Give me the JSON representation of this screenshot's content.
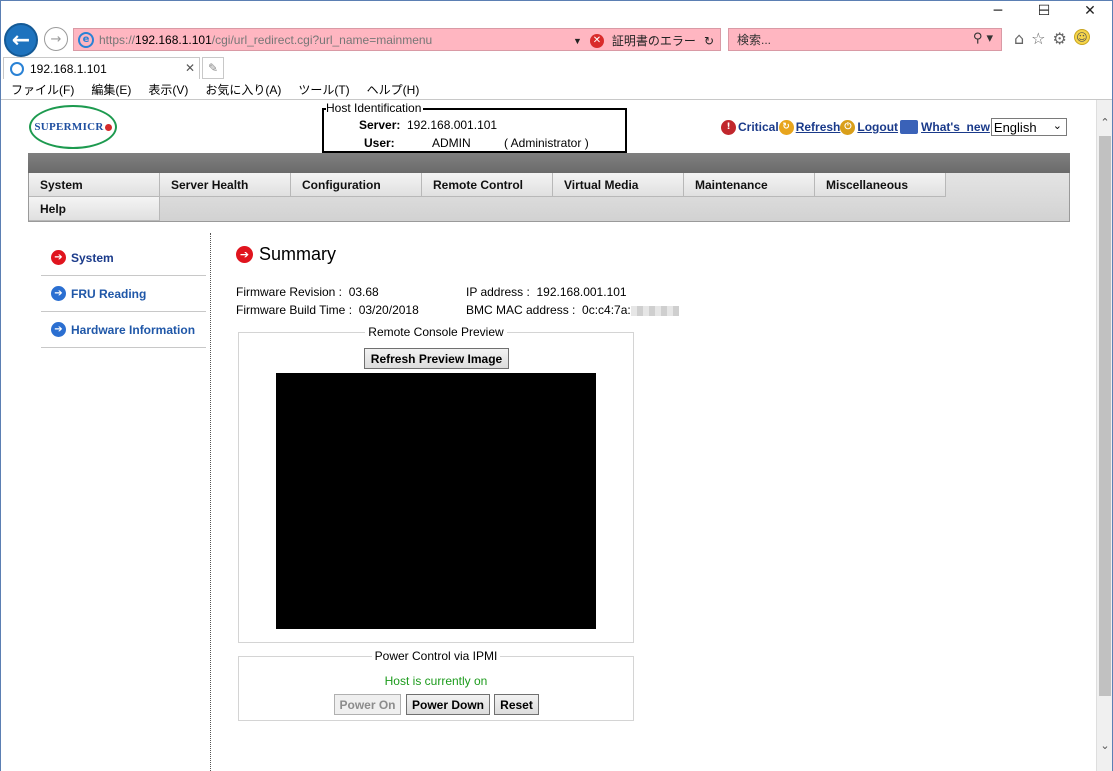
{
  "browser": {
    "window_controls": {
      "minimize": "─",
      "maximize": "☐",
      "close": "✕"
    },
    "back_icon": "back-arrow-icon",
    "forward_icon": "forward-arrow-icon",
    "address": {
      "scheme": "https://",
      "host": "192.168.1.101",
      "path": "/cgi/url_redirect.cgi?url_name=mainmenu",
      "cert_error": "証明書のエラー"
    },
    "search_placeholder": "検索...",
    "tab_title": "192.168.1.101",
    "menu": [
      "ファイル(F)",
      "編集(E)",
      "表示(V)",
      "お気に入り(A)",
      "ツール(T)",
      "ヘルプ(H)"
    ]
  },
  "header": {
    "logo_text": "SUPERMICR",
    "host_identification": {
      "legend": "Host Identification",
      "server_label": "Server:",
      "server_value": "192.168.001.101",
      "user_label": "User:",
      "user_value": "ADMIN",
      "user_role": "( Administrator )"
    },
    "links": {
      "critical": "Critical",
      "refresh": "Refresh",
      "logout": "Logout",
      "whats_new": "What's_new"
    },
    "language": "English"
  },
  "nav": {
    "items": [
      "System",
      "Server Health",
      "Configuration",
      "Remote Control",
      "Virtual Media",
      "Maintenance",
      "Miscellaneous"
    ],
    "items_row2": [
      "Help"
    ]
  },
  "sidebar": {
    "items": [
      {
        "label": "System",
        "active": true
      },
      {
        "label": "FRU Reading",
        "active": false
      },
      {
        "label": "Hardware Information",
        "active": false
      }
    ]
  },
  "summary": {
    "title": "Summary",
    "firmware_revision_label": "Firmware Revision :",
    "firmware_revision": "03.68",
    "firmware_build_label": "Firmware Build Time :",
    "firmware_build": "03/20/2018",
    "ip_label": "IP address :",
    "ip_value": "192.168.001.101",
    "mac_label": "BMC MAC address :",
    "mac_value": "0c:c4:7a:"
  },
  "remote_console": {
    "legend": "Remote Console Preview",
    "refresh_button": "Refresh Preview Image"
  },
  "power_control": {
    "legend": "Power Control via IPMI",
    "status": "Host is currently on",
    "power_on": "Power On",
    "power_down": "Power Down",
    "reset": "Reset"
  },
  "colors": {
    "address_bar_error": "#ffb6c1",
    "nav_gray": "#767676",
    "link_blue": "#1a3a8a",
    "status_green": "#1c9b1c",
    "arrow_red": "#e0141e",
    "arrow_blue": "#2b6fd1"
  }
}
